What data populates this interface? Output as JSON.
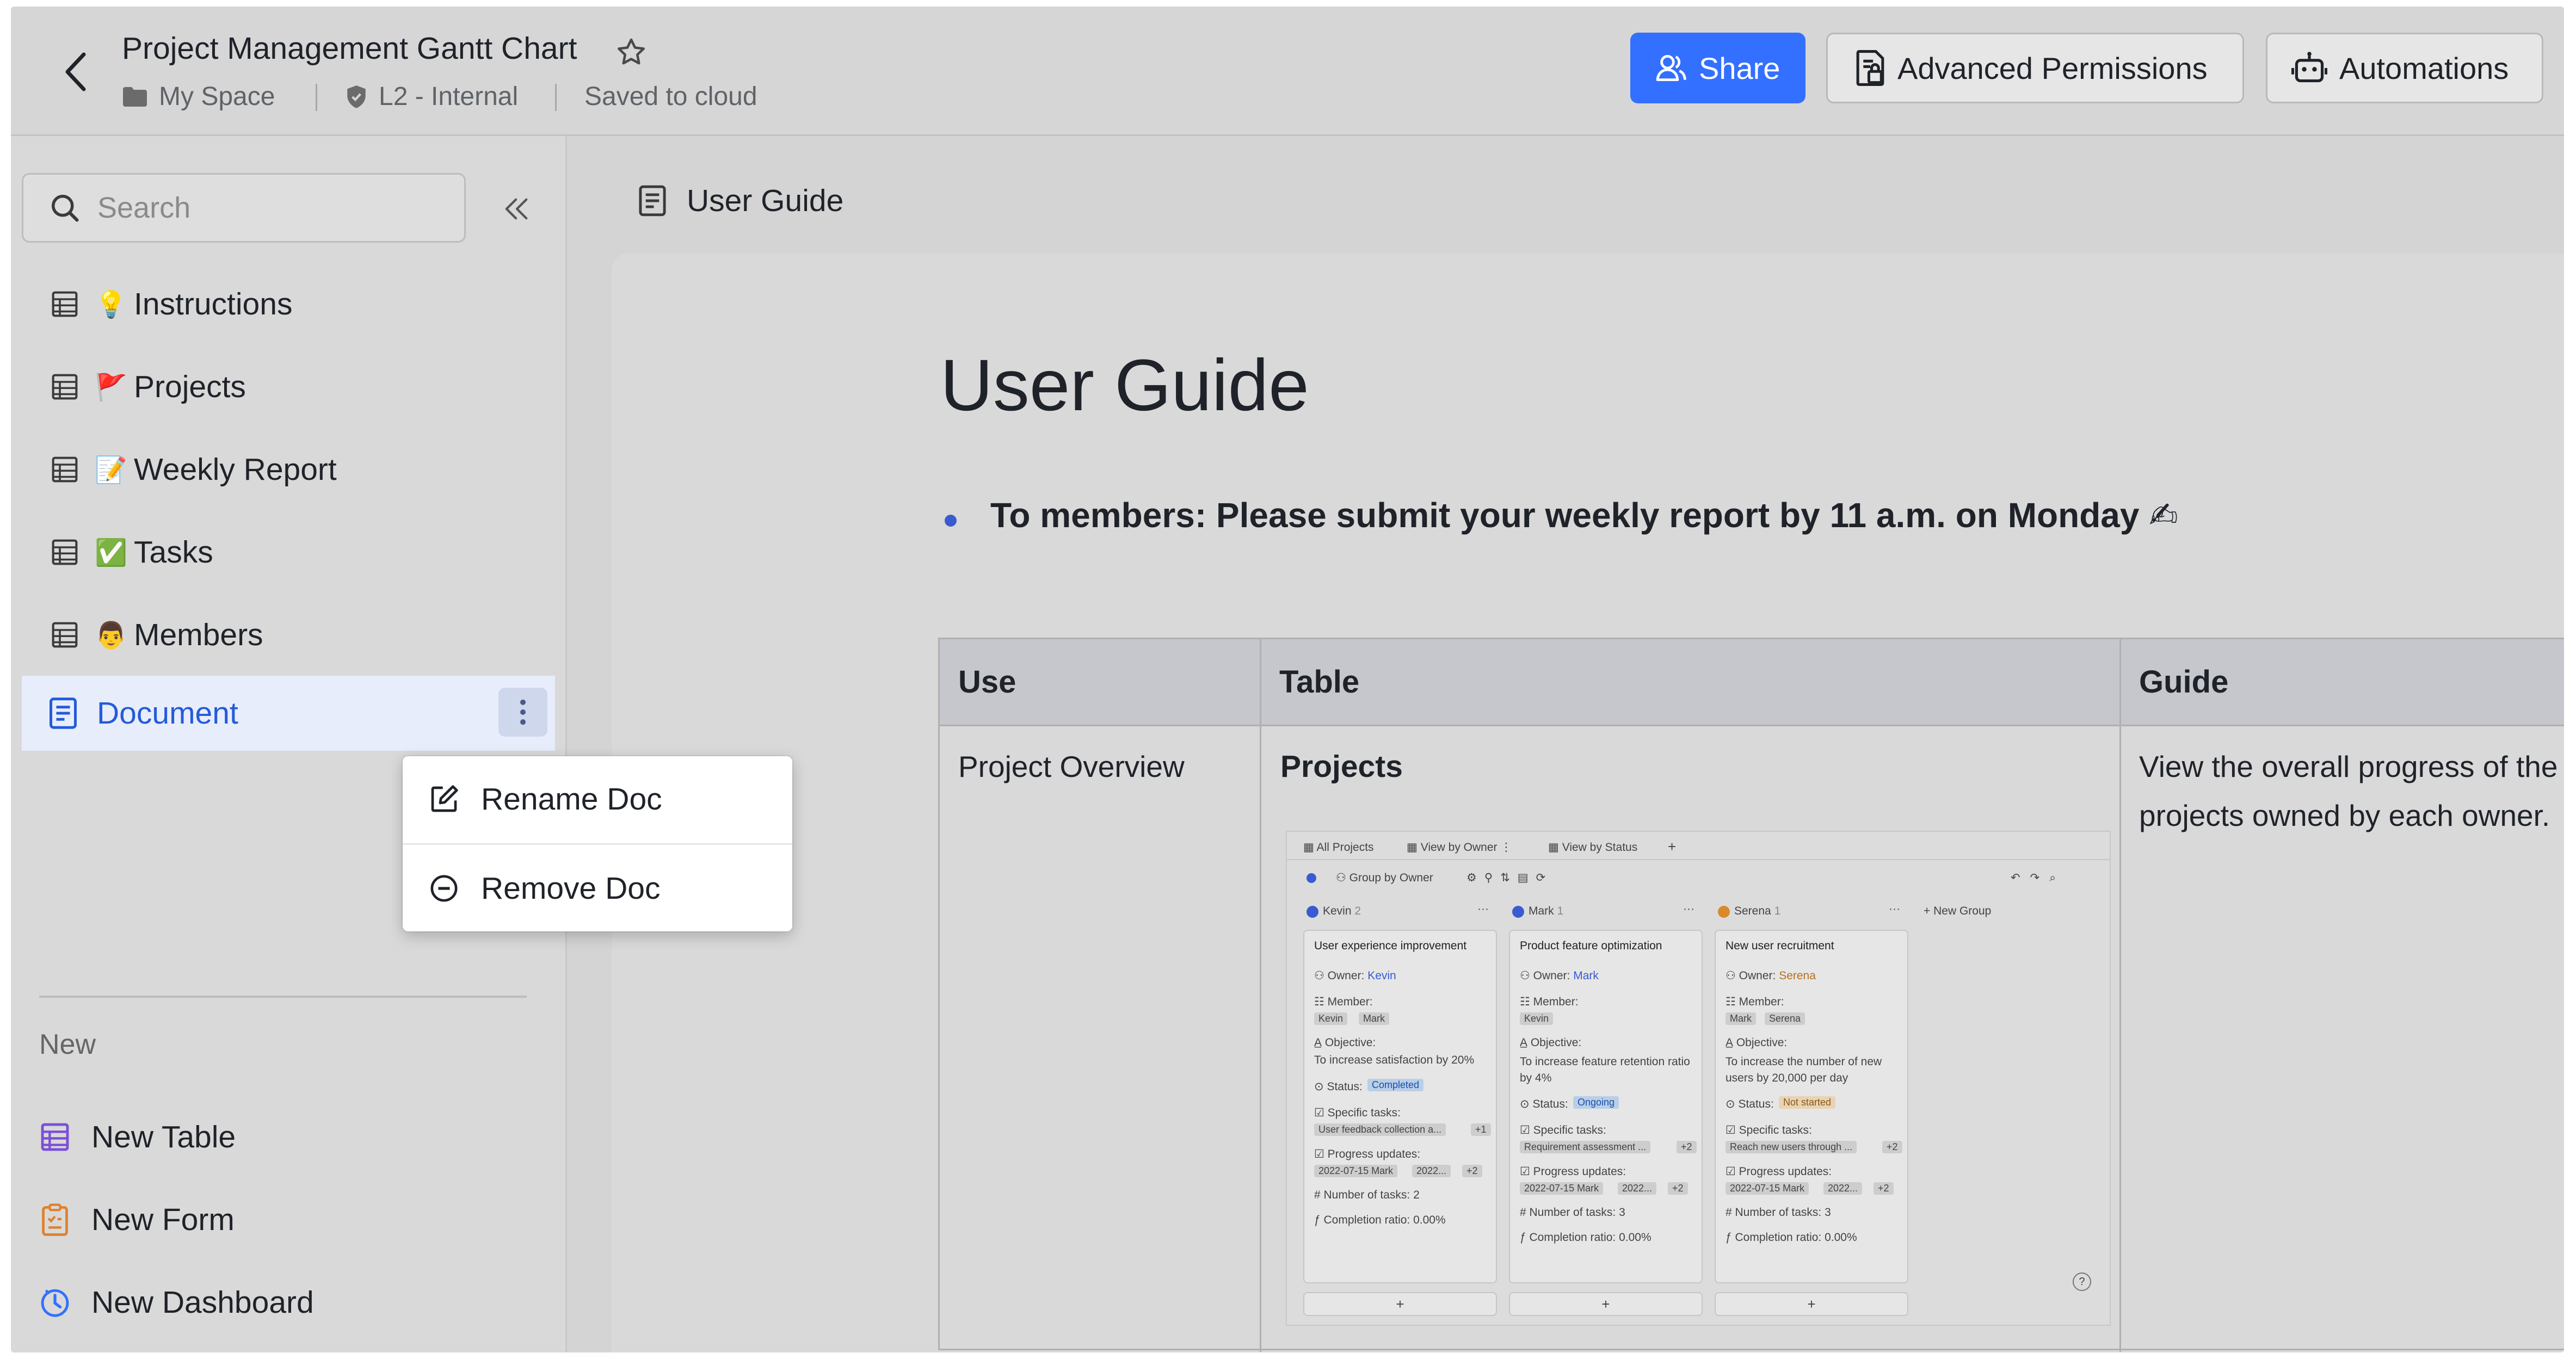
{
  "header": {
    "title": "Project Management Gantt Chart",
    "space": "My Space",
    "security": "L2 - Internal",
    "save_status": "Saved to cloud",
    "share_label": "Share",
    "advanced_permissions_label": "Advanced Permissions",
    "automations_label": "Automations"
  },
  "sidebar": {
    "search_placeholder": "Search",
    "items": [
      {
        "icon": "table-icon",
        "emoji": "💡",
        "label": "Instructions"
      },
      {
        "icon": "table-icon",
        "emoji": "🚩",
        "label": "Projects"
      },
      {
        "icon": "table-icon",
        "emoji": "📝",
        "label": "Weekly Report"
      },
      {
        "icon": "table-icon",
        "emoji": "✅",
        "label": "Tasks"
      },
      {
        "icon": "table-icon",
        "emoji": "👨",
        "label": "Members"
      },
      {
        "icon": "doc-icon",
        "emoji": "",
        "label": "Document"
      }
    ],
    "new_section_label": "New",
    "new_items": [
      {
        "icon": "new-table-icon",
        "label": "New Table",
        "color": "#7a4fd6"
      },
      {
        "icon": "new-form-icon",
        "label": "New Form",
        "color": "#e0812c"
      },
      {
        "icon": "new-dashboard-icon",
        "label": "New Dashboard",
        "color": "#3370ff"
      }
    ]
  },
  "context_menu": {
    "items": [
      {
        "icon": "edit-icon",
        "label": "Rename Doc"
      },
      {
        "icon": "remove-icon",
        "label": "Remove Doc"
      }
    ]
  },
  "main": {
    "tab_title": "User Guide",
    "heading": "User Guide",
    "bullet": "To members: Please submit your weekly report by 11 a.m. on Monday ✍",
    "table": {
      "headers": [
        "Use",
        "Table",
        "Guide"
      ],
      "rows": [
        {
          "use": "Project Overview",
          "table": "Projects",
          "guide_line1": "View the overall progress of the",
          "guide_line2": "projects owned by each owner."
        }
      ]
    },
    "preview": {
      "views": [
        "All Projects",
        "View by Owner",
        "View by Status"
      ],
      "group_by": "Group by Owner",
      "groups": [
        {
          "owner": "Kevin",
          "count": "2",
          "color": "#3a5bd0",
          "card_title": "User experience improvement",
          "owner_label": "Kevin",
          "members": [
            "Kevin",
            "Mark"
          ],
          "objective": "To increase satisfaction by 20%",
          "status": "Completed",
          "status_color": "#b9cfe8",
          "task": "User feedback collection a...",
          "task_more": "+1",
          "update": "2022-07-15 Mark",
          "update2": "2022...",
          "update_more": "+2",
          "num_tasks": "2",
          "completion": "0.00%"
        },
        {
          "owner": "Mark",
          "count": "1",
          "color": "#3a5bd0",
          "card_title": "Product feature optimization",
          "owner_label": "Mark",
          "members": [
            "Kevin"
          ],
          "objective": "To increase feature retention ratio by 4%",
          "status": "Ongoing",
          "status_color": "#b9cfe8",
          "task": "Requirement assessment ...",
          "task_more": "+2",
          "update": "2022-07-15 Mark",
          "update2": "2022...",
          "update_more": "+2",
          "num_tasks": "3",
          "completion": "0.00%"
        },
        {
          "owner": "Serena",
          "count": "1",
          "color": "#d98a2b",
          "card_title": "New user recruitment",
          "owner_label": "Serena",
          "members": [
            "Mark",
            "Serena"
          ],
          "objective": "To increase the number of new users by 20,000 per day",
          "status": "Not started",
          "status_color": "#e9d3b5",
          "task": "Reach new users through ...",
          "task_more": "+2",
          "update": "2022-07-15 Mark",
          "update2": "2022...",
          "update_more": "+2",
          "num_tasks": "3",
          "completion": "0.00%"
        }
      ],
      "new_group": "New Group",
      "labels": {
        "owner": "Owner:",
        "member": "Member:",
        "objective": "Objective:",
        "status": "Status:",
        "tasks": "Specific tasks:",
        "updates": "Progress updates:",
        "num": "Number of tasks:",
        "ratio": "Completion ratio:"
      }
    }
  },
  "colors": {
    "accent": "#3370ff",
    "selected_bg": "#e8edfb",
    "selected_text": "#245bdb"
  }
}
